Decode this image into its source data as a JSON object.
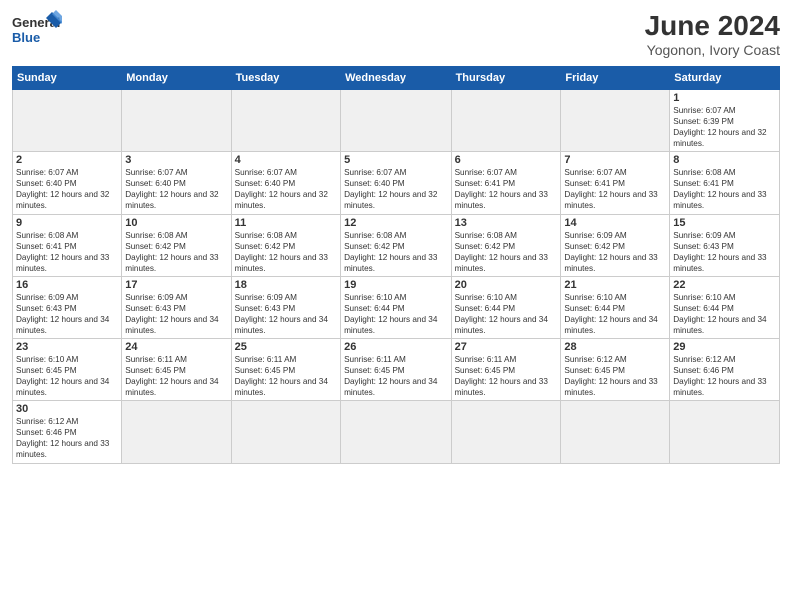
{
  "header": {
    "logo_general": "General",
    "logo_blue": "Blue",
    "month_year": "June 2024",
    "location": "Yogonon, Ivory Coast"
  },
  "days_of_week": [
    "Sunday",
    "Monday",
    "Tuesday",
    "Wednesday",
    "Thursday",
    "Friday",
    "Saturday"
  ],
  "weeks": [
    [
      {
        "day": "",
        "empty": true
      },
      {
        "day": "",
        "empty": true
      },
      {
        "day": "",
        "empty": true
      },
      {
        "day": "",
        "empty": true
      },
      {
        "day": "",
        "empty": true
      },
      {
        "day": "",
        "empty": true
      },
      {
        "day": "1",
        "sunrise": "6:07 AM",
        "sunset": "6:39 PM",
        "daylight": "12 hours and 32 minutes."
      }
    ],
    [
      {
        "day": "2",
        "sunrise": "6:07 AM",
        "sunset": "6:40 PM",
        "daylight": "12 hours and 32 minutes."
      },
      {
        "day": "3",
        "sunrise": "6:07 AM",
        "sunset": "6:40 PM",
        "daylight": "12 hours and 32 minutes."
      },
      {
        "day": "4",
        "sunrise": "6:07 AM",
        "sunset": "6:40 PM",
        "daylight": "12 hours and 32 minutes."
      },
      {
        "day": "5",
        "sunrise": "6:07 AM",
        "sunset": "6:40 PM",
        "daylight": "12 hours and 32 minutes."
      },
      {
        "day": "6",
        "sunrise": "6:07 AM",
        "sunset": "6:41 PM",
        "daylight": "12 hours and 33 minutes."
      },
      {
        "day": "7",
        "sunrise": "6:07 AM",
        "sunset": "6:41 PM",
        "daylight": "12 hours and 33 minutes."
      },
      {
        "day": "8",
        "sunrise": "6:08 AM",
        "sunset": "6:41 PM",
        "daylight": "12 hours and 33 minutes."
      }
    ],
    [
      {
        "day": "9",
        "sunrise": "6:08 AM",
        "sunset": "6:41 PM",
        "daylight": "12 hours and 33 minutes."
      },
      {
        "day": "10",
        "sunrise": "6:08 AM",
        "sunset": "6:42 PM",
        "daylight": "12 hours and 33 minutes."
      },
      {
        "day": "11",
        "sunrise": "6:08 AM",
        "sunset": "6:42 PM",
        "daylight": "12 hours and 33 minutes."
      },
      {
        "day": "12",
        "sunrise": "6:08 AM",
        "sunset": "6:42 PM",
        "daylight": "12 hours and 33 minutes."
      },
      {
        "day": "13",
        "sunrise": "6:08 AM",
        "sunset": "6:42 PM",
        "daylight": "12 hours and 33 minutes."
      },
      {
        "day": "14",
        "sunrise": "6:09 AM",
        "sunset": "6:42 PM",
        "daylight": "12 hours and 33 minutes."
      },
      {
        "day": "15",
        "sunrise": "6:09 AM",
        "sunset": "6:43 PM",
        "daylight": "12 hours and 33 minutes."
      }
    ],
    [
      {
        "day": "16",
        "sunrise": "6:09 AM",
        "sunset": "6:43 PM",
        "daylight": "12 hours and 34 minutes."
      },
      {
        "day": "17",
        "sunrise": "6:09 AM",
        "sunset": "6:43 PM",
        "daylight": "12 hours and 34 minutes."
      },
      {
        "day": "18",
        "sunrise": "6:09 AM",
        "sunset": "6:43 PM",
        "daylight": "12 hours and 34 minutes."
      },
      {
        "day": "19",
        "sunrise": "6:10 AM",
        "sunset": "6:44 PM",
        "daylight": "12 hours and 34 minutes."
      },
      {
        "day": "20",
        "sunrise": "6:10 AM",
        "sunset": "6:44 PM",
        "daylight": "12 hours and 34 minutes."
      },
      {
        "day": "21",
        "sunrise": "6:10 AM",
        "sunset": "6:44 PM",
        "daylight": "12 hours and 34 minutes."
      },
      {
        "day": "22",
        "sunrise": "6:10 AM",
        "sunset": "6:44 PM",
        "daylight": "12 hours and 34 minutes."
      }
    ],
    [
      {
        "day": "23",
        "sunrise": "6:10 AM",
        "sunset": "6:45 PM",
        "daylight": "12 hours and 34 minutes."
      },
      {
        "day": "24",
        "sunrise": "6:11 AM",
        "sunset": "6:45 PM",
        "daylight": "12 hours and 34 minutes."
      },
      {
        "day": "25",
        "sunrise": "6:11 AM",
        "sunset": "6:45 PM",
        "daylight": "12 hours and 34 minutes."
      },
      {
        "day": "26",
        "sunrise": "6:11 AM",
        "sunset": "6:45 PM",
        "daylight": "12 hours and 34 minutes."
      },
      {
        "day": "27",
        "sunrise": "6:11 AM",
        "sunset": "6:45 PM",
        "daylight": "12 hours and 33 minutes."
      },
      {
        "day": "28",
        "sunrise": "6:12 AM",
        "sunset": "6:45 PM",
        "daylight": "12 hours and 33 minutes."
      },
      {
        "day": "29",
        "sunrise": "6:12 AM",
        "sunset": "6:46 PM",
        "daylight": "12 hours and 33 minutes."
      }
    ],
    [
      {
        "day": "30",
        "sunrise": "6:12 AM",
        "sunset": "6:46 PM",
        "daylight": "12 hours and 33 minutes."
      },
      {
        "day": "",
        "empty": true
      },
      {
        "day": "",
        "empty": true
      },
      {
        "day": "",
        "empty": true
      },
      {
        "day": "",
        "empty": true
      },
      {
        "day": "",
        "empty": true
      },
      {
        "day": "",
        "empty": true
      }
    ]
  ]
}
